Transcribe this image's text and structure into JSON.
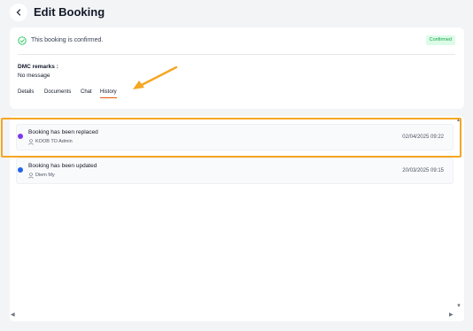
{
  "header": {
    "title": "Edit Booking"
  },
  "status": {
    "message": "This booking is confirmed.",
    "badge": "Confirmed"
  },
  "remarks": {
    "label": "DMC remarks :",
    "value": "No message"
  },
  "tabs": [
    {
      "label": "Details",
      "active": false
    },
    {
      "label": "Documents",
      "active": false
    },
    {
      "label": "Chat",
      "active": false
    },
    {
      "label": "History",
      "active": true
    }
  ],
  "history": [
    {
      "title": "Booking has been replaced",
      "user": "KOOB TO Admin",
      "date": "02/04/2025 09:22",
      "dot_color": "#7c3aed"
    },
    {
      "title": "Booking has been updated",
      "user": "Diem My",
      "date": "20/03/2025 09:15",
      "dot_color": "#2563eb"
    }
  ],
  "colors": {
    "accent": "#ea580c",
    "annotation": "#f5a623",
    "confirmed": "#16a34a"
  },
  "icons": [
    "back-arrow-icon",
    "check-circle-icon",
    "user-icon",
    "annotation-arrow"
  ]
}
